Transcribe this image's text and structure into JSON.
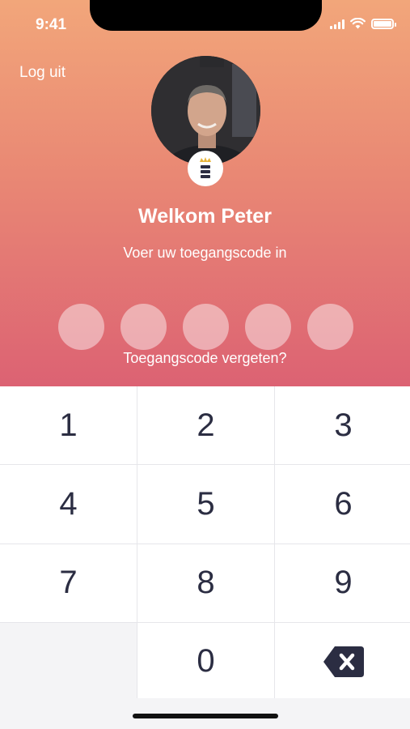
{
  "status_bar": {
    "time": "9:41"
  },
  "header": {
    "logout_label": "Log uit"
  },
  "profile": {
    "greeting": "Welkom Peter",
    "instruction": "Voer uw toegangscode in"
  },
  "pin": {
    "length": 5,
    "entered": 0,
    "forgot_label": "Toegangscode vergeten?"
  },
  "keypad": {
    "keys": [
      "1",
      "2",
      "3",
      "4",
      "5",
      "6",
      "7",
      "8",
      "9",
      "",
      "0",
      "delete"
    ]
  },
  "colors": {
    "gradient_top": "#f2a67a",
    "gradient_bottom": "#dc6273",
    "key_text": "#2b2d42",
    "badge_crown": "#e7b43a"
  }
}
